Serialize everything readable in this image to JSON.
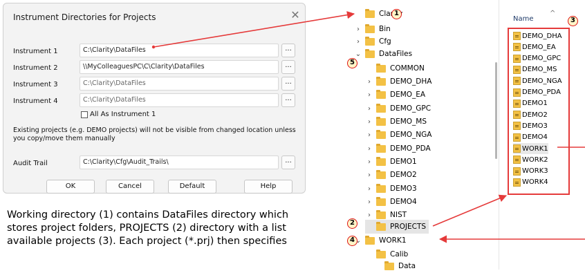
{
  "dialog": {
    "title": "Instrument Directories for Projects",
    "close_glyph": "✕",
    "rows": [
      {
        "label": "Instrument 1",
        "value": "C:\\Clarity\\DataFiles"
      },
      {
        "label": "Instrument 2",
        "value": "\\\\MyColleaguesPC\\C\\Clarity\\DataFiles"
      },
      {
        "label": "Instrument 3",
        "value": "C:\\Clarity\\DataFiles"
      },
      {
        "label": "Instrument 4",
        "value": "C:\\Clarity\\DataFiles"
      }
    ],
    "browse_label": "...",
    "checkbox_label": "All As Instrument 1",
    "note": "Existing projects (e.g. DEMO projects) will not be visible from changed location unless you copy/move them manually",
    "audit_label": "Audit Trail",
    "audit_value": "C:\\Clarity\\Cfg\\Audit_Trails\\",
    "buttons": {
      "ok": "OK",
      "cancel": "Cancel",
      "default": "Default",
      "help": "Help"
    }
  },
  "caption": "Working directory (1) contains DataFiles directory which stores project folders, PROJECTS (2) directory with a list available projects (3). Each project (*.prj) then specifies",
  "tree": {
    "items": [
      {
        "label": "Clarity",
        "chevron": "",
        "selected": false
      },
      {
        "label": "Bin",
        "chevron": "›",
        "selected": false
      },
      {
        "label": "Cfg",
        "chevron": "›",
        "selected": false
      },
      {
        "label": "DataFiles",
        "chevron": "⌄",
        "selected": false
      },
      {
        "label": "COMMON",
        "chevron": "",
        "selected": false
      },
      {
        "label": "DEMO_DHA",
        "chevron": "›",
        "selected": false
      },
      {
        "label": "DEMO_EA",
        "chevron": "›",
        "selected": false
      },
      {
        "label": "DEMO_GPC",
        "chevron": "›",
        "selected": false
      },
      {
        "label": "DEMO_MS",
        "chevron": "›",
        "selected": false
      },
      {
        "label": "DEMO_NGA",
        "chevron": "›",
        "selected": false
      },
      {
        "label": "DEMO_PDA",
        "chevron": "›",
        "selected": false
      },
      {
        "label": "DEMO1",
        "chevron": "›",
        "selected": false
      },
      {
        "label": "DEMO2",
        "chevron": "›",
        "selected": false
      },
      {
        "label": "DEMO3",
        "chevron": "›",
        "selected": false
      },
      {
        "label": "DEMO4",
        "chevron": "›",
        "selected": false
      },
      {
        "label": "NIST",
        "chevron": "›",
        "selected": false
      },
      {
        "label": "PROJECTS",
        "chevron": "",
        "selected": true
      },
      {
        "label": "WORK1",
        "chevron": "⌄",
        "selected": false
      },
      {
        "label": "Calib",
        "chevron": "",
        "selected": false
      },
      {
        "label": "Data",
        "chevron": "",
        "selected": false
      }
    ]
  },
  "filelist": {
    "column_name": "Name",
    "sort_glyph": "^",
    "items": [
      "DEMO_DHA",
      "DEMO_EA",
      "DEMO_GPC",
      "DEMO_MS",
      "DEMO_NGA",
      "DEMO_PDA",
      "DEMO1",
      "DEMO2",
      "DEMO3",
      "DEMO4",
      "WORK1",
      "WORK2",
      "WORK3",
      "WORK4"
    ]
  },
  "badges": [
    "1",
    "2",
    "3",
    "4",
    "5"
  ],
  "colors": {
    "annotation_red": "#e53a3a",
    "folder_yellow": "#f3c145"
  }
}
